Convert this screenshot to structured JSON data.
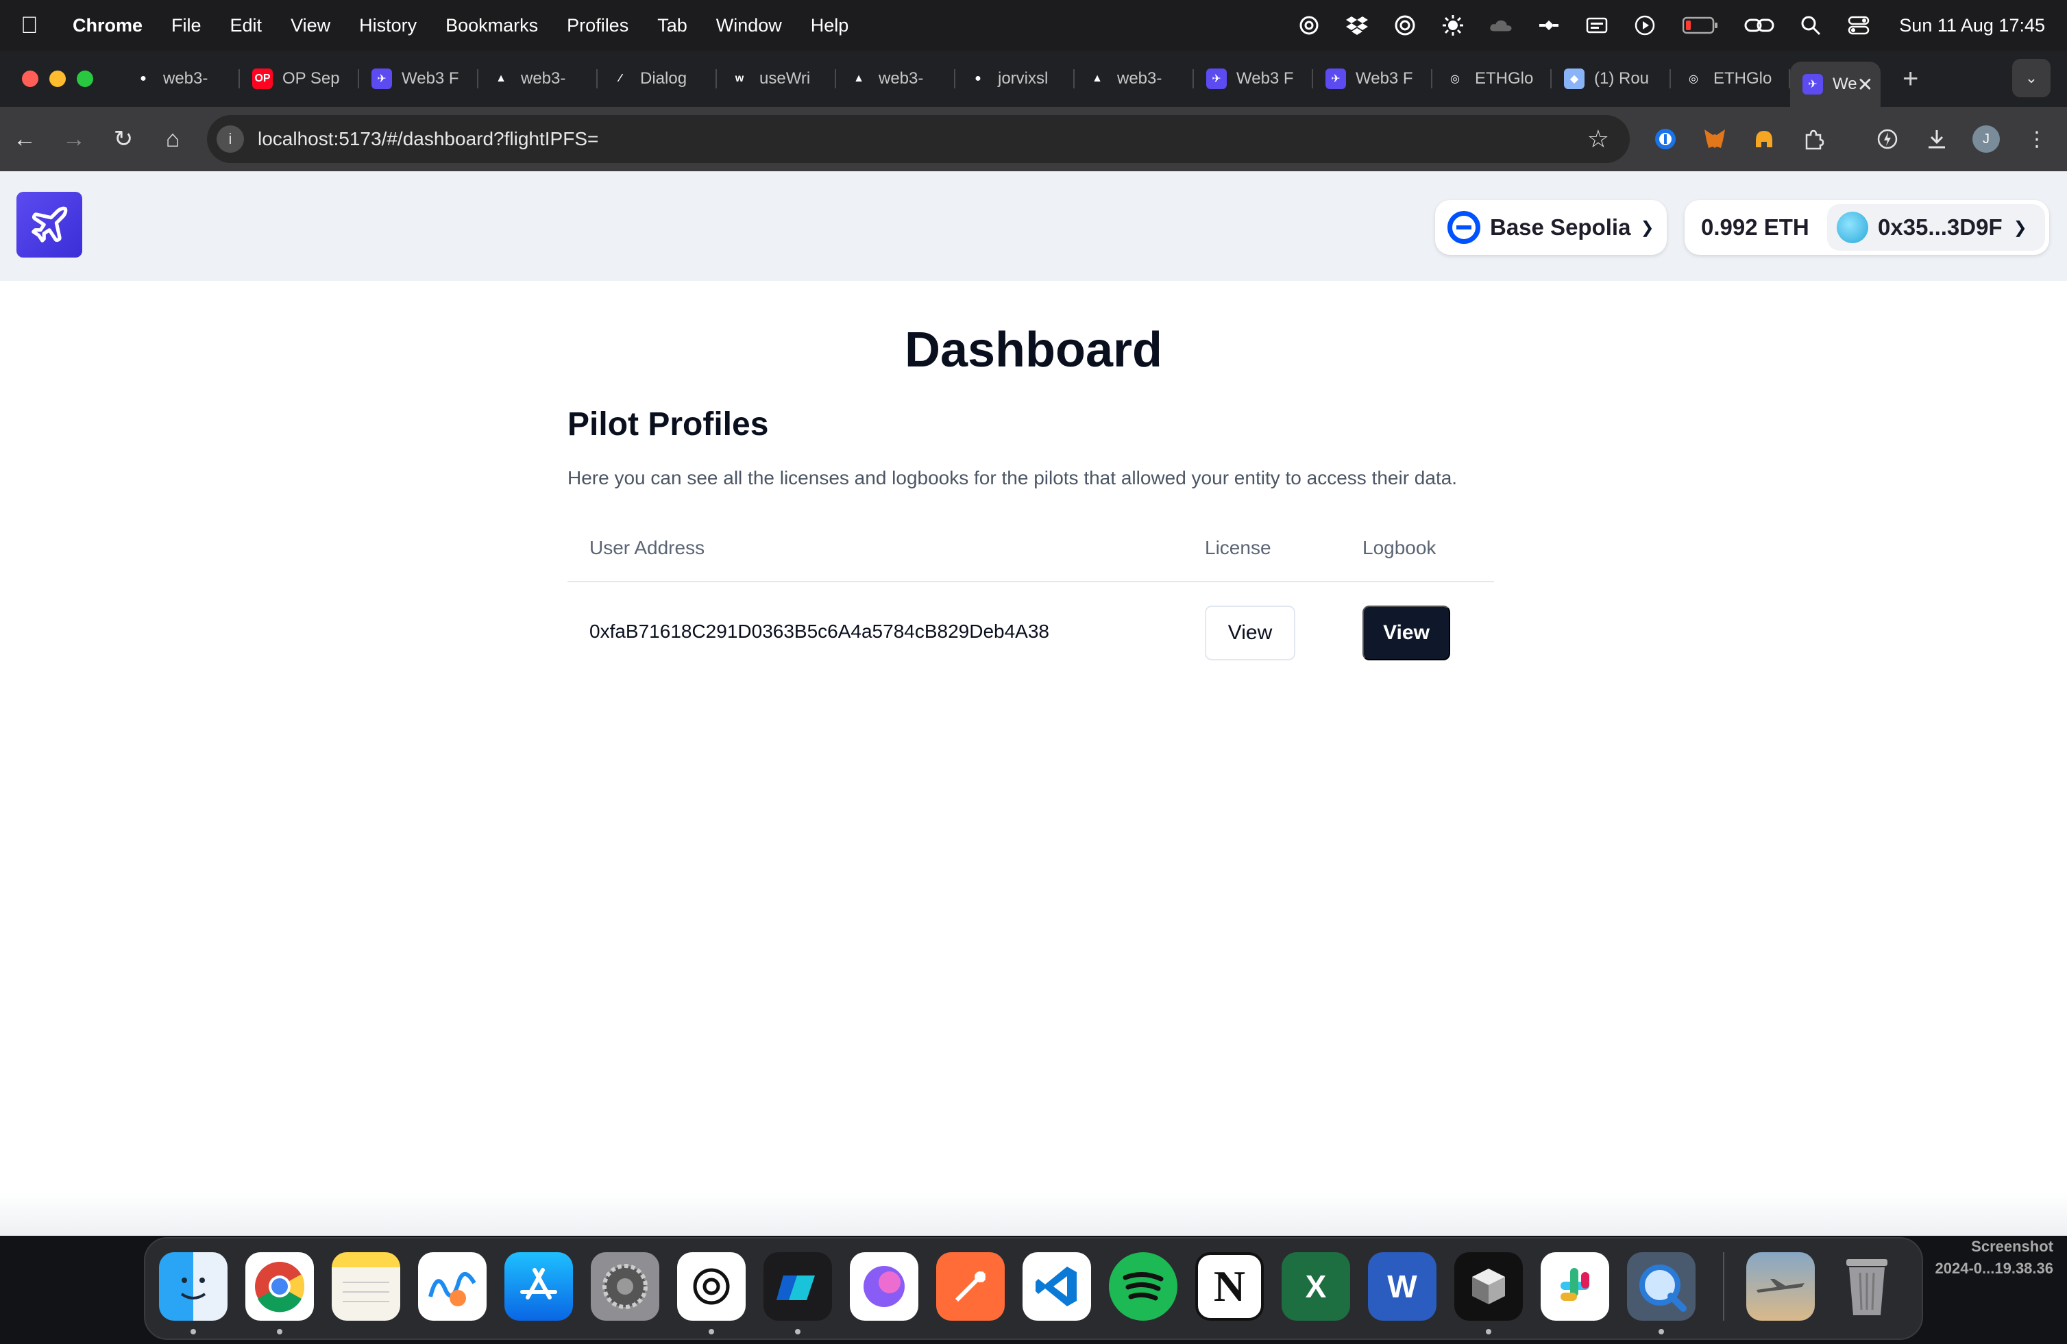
{
  "menubar": {
    "app": "Chrome",
    "items": [
      "File",
      "Edit",
      "View",
      "History",
      "Bookmarks",
      "Profiles",
      "Tab",
      "Window",
      "Help"
    ],
    "clock": "Sun 11 Aug  17:45"
  },
  "tabs": [
    {
      "label": "web3-",
      "icon": "github-icon",
      "color": "#ffffff"
    },
    {
      "label": "OP Sep",
      "icon": "optimism-icon",
      "color": "#ff0420"
    },
    {
      "label": "Web3 F",
      "icon": "web3-app-icon",
      "color": "#5b4bf0"
    },
    {
      "label": "web3-",
      "icon": "vercel-icon",
      "color": "#ffffff"
    },
    {
      "label": "Dialog",
      "icon": "shadcn-icon",
      "color": "#ffffff"
    },
    {
      "label": "useWri",
      "icon": "wagmi-icon",
      "color": "#ffffff"
    },
    {
      "label": "web3-",
      "icon": "vercel-icon",
      "color": "#ffffff"
    },
    {
      "label": "jorvixsl",
      "icon": "github-icon",
      "color": "#ffffff"
    },
    {
      "label": "web3-",
      "icon": "vercel-icon",
      "color": "#ffffff"
    },
    {
      "label": "Web3 F",
      "icon": "web3-app-icon",
      "color": "#5b4bf0"
    },
    {
      "label": "Web3 F",
      "icon": "web3-app-icon",
      "color": "#5b4bf0"
    },
    {
      "label": "ETHGlo",
      "icon": "ethglobal-icon",
      "color": "#ffffff"
    },
    {
      "label": "(1) Rou",
      "icon": "gem-icon",
      "color": "#8ab4f8"
    },
    {
      "label": "ETHGlo",
      "icon": "ethglobal-icon",
      "color": "#ffffff"
    }
  ],
  "active_tab": {
    "label": "We",
    "icon": "web3-app-icon"
  },
  "address_bar": {
    "url": "localhost:5173/#/dashboard?flightIPFS="
  },
  "header": {
    "network": "Base Sepolia",
    "balance": "0.992 ETH",
    "account": "0x35...3D9F"
  },
  "main": {
    "title": "Dashboard",
    "section_title": "Pilot Profiles",
    "description": "Here you can see all the licenses and logbooks for the pilots that allowed your entity to access their data.",
    "columns": [
      "User Address",
      "License",
      "Logbook"
    ],
    "rows": [
      {
        "address": "0xfaB71618C291D0363B5c6A4a5784cB829Deb4A38",
        "license_button": "View",
        "logbook_button": "View"
      }
    ]
  },
  "dock": {
    "apps": [
      "Finder",
      "Google Chrome",
      "Notes",
      "Freeform",
      "App Store",
      "System Settings",
      "ChatGPT",
      "Cursor",
      "Arc Search",
      "Postman",
      "Visual Studio Code",
      "Spotify",
      "Notion",
      "Microsoft Excel",
      "Microsoft Word",
      "Cube",
      "Slack",
      "QuickTime Player"
    ],
    "screenshot_label": [
      "Screenshot",
      "2024-0...19.38.36"
    ]
  },
  "colors": {
    "accent": "#5b4bf0",
    "dark_button": "#0f172a",
    "base_blue": "#0052ff"
  }
}
